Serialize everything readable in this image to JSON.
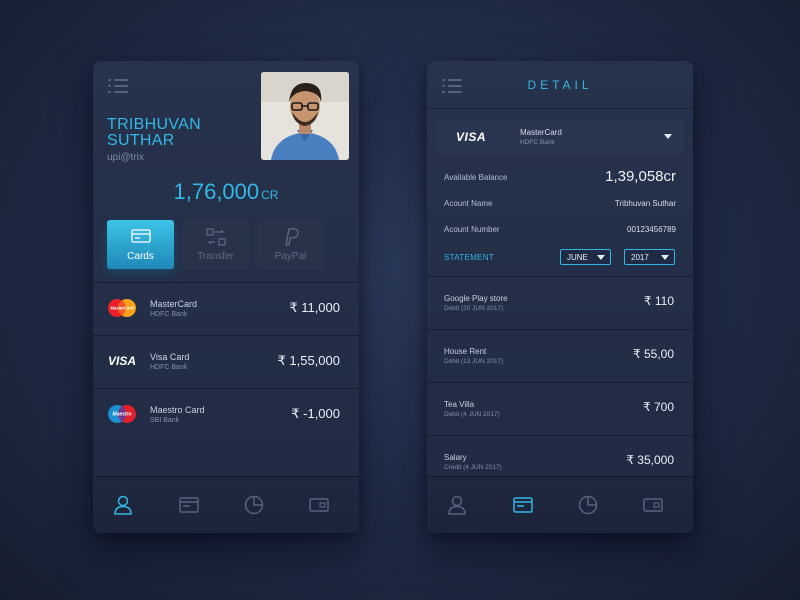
{
  "left": {
    "user": {
      "first_name": "TRIBHUVAN",
      "last_name": "SUTHAR",
      "handle": "upi@trix"
    },
    "balance": {
      "amount": "1,76,000",
      "currency": "CR"
    },
    "tabs": [
      {
        "label": "Cards",
        "icon": "card-icon",
        "active": true
      },
      {
        "label": "Transfer",
        "icon": "transfer-icon",
        "active": false
      },
      {
        "label": "PayPal",
        "icon": "paypal-icon",
        "active": false
      }
    ],
    "cards": [
      {
        "name": "MasterCard",
        "bank": "HDFC Bank",
        "amount": "₹ 11,000",
        "logo": "mastercard-logo",
        "logo_text": "MasterCard"
      },
      {
        "name": "Visa Card",
        "bank": "HDFC Bank",
        "amount": "₹ 1,55,000",
        "logo": "visa-logo",
        "logo_text": "VISA"
      },
      {
        "name": "Maestro Card",
        "bank": "SBI Bank",
        "amount": "₹ -1,000",
        "logo": "maestro-logo",
        "logo_text": "Maestro"
      }
    ],
    "nav": [
      "profile-icon",
      "statement-icon",
      "pie-chart-icon",
      "wallet-card-icon"
    ],
    "active_nav": 0
  },
  "right": {
    "title": "DETAIL",
    "selected_card": {
      "logo_text": "VISA",
      "name": "MasterCard",
      "bank": "HDFC Bank"
    },
    "details": [
      {
        "key": "Available Balance",
        "value": "1,39,058cr"
      },
      {
        "key": "Acount Name",
        "value": "Tribhuvan Suthar"
      },
      {
        "key": "Acount Number",
        "value": "00123456789"
      }
    ],
    "statement": {
      "label": "STATEMENT",
      "month": "JUNE",
      "year": "2017"
    },
    "transactions": [
      {
        "name": "Google Play store",
        "sub": "Debit (20 JUN 2017)",
        "amount": "₹ 110"
      },
      {
        "name": "House Rent",
        "sub": "Debit (13 JUN 2017)",
        "amount": "₹ 55,00"
      },
      {
        "name": "Tea Villa",
        "sub": "Debit (4 JUN 2017)",
        "amount": "₹ 700"
      },
      {
        "name": "Salary",
        "sub": "Credit (4 JUN 2017)",
        "amount": "₹ 35,000"
      }
    ],
    "nav": [
      "profile-icon",
      "statement-icon",
      "pie-chart-icon",
      "wallet-card-icon"
    ],
    "active_nav": 1
  },
  "colors": {
    "accent": "#33b7e6",
    "background": "#1f2a44",
    "panel": "#242e47",
    "muted": "#56627e"
  }
}
